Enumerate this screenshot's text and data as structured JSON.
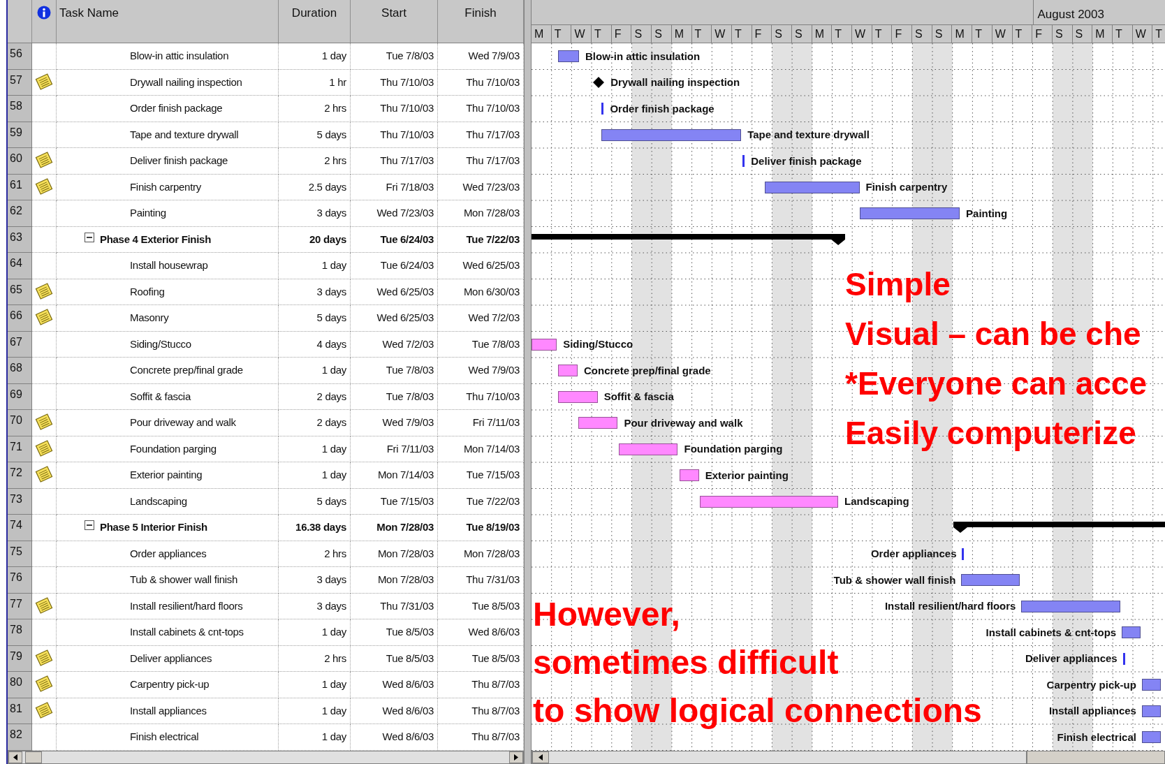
{
  "table": {
    "columns": [
      "Task Name",
      "Duration",
      "Start",
      "Finish"
    ],
    "rows": [
      {
        "kind": "task",
        "id": "56",
        "note": false,
        "name": "Blow-in attic insulation",
        "duration": "1 day",
        "start": "Tue 7/8/03",
        "finish": "Wed 7/9/03",
        "bar_label": "Blow-in attic insulation",
        "color": "#8484f4"
      },
      {
        "kind": "task",
        "id": "57",
        "note": true,
        "name": "Drywall nailing inspection",
        "duration": "1 hr",
        "start": "Thu 7/10/03",
        "finish": "Thu 7/10/03",
        "bar_label": "Drywall nailing inspection"
      },
      {
        "kind": "task",
        "id": "58",
        "note": false,
        "name": "Order finish package",
        "duration": "2 hrs",
        "start": "Thu 7/10/03",
        "finish": "Thu 7/10/03",
        "bar_label": "Order finish package",
        "color": "#3333ee"
      },
      {
        "kind": "task",
        "id": "59",
        "note": false,
        "name": "Tape and texture drywall",
        "duration": "5 days",
        "start": "Thu 7/10/03",
        "finish": "Thu 7/17/03",
        "bar_label": "Tape and texture drywall",
        "color": "#8484f4"
      },
      {
        "kind": "task",
        "id": "60",
        "note": true,
        "name": "Deliver finish package",
        "duration": "2 hrs",
        "start": "Thu 7/17/03",
        "finish": "Thu 7/17/03",
        "bar_label": "Deliver finish package",
        "color": "#3333ee"
      },
      {
        "kind": "task",
        "id": "61",
        "note": true,
        "name": "Finish carpentry",
        "duration": "2.5 days",
        "start": "Fri 7/18/03",
        "finish": "Wed 7/23/03",
        "bar_label": "Finish carpentry",
        "color": "#8484f4"
      },
      {
        "kind": "task",
        "id": "62",
        "note": false,
        "name": "Painting",
        "duration": "3 days",
        "start": "Wed 7/23/03",
        "finish": "Mon 7/28/03",
        "bar_label": "Painting",
        "color": "#8484f4"
      },
      {
        "kind": "summary",
        "id": "63",
        "expanded": true,
        "note": false,
        "name": "Phase 4 Exterior Finish",
        "duration": "20 days",
        "start": "Tue 6/24/03",
        "finish": "Tue 7/22/03",
        "children": [
          {
            "kind": "task",
            "id": "64",
            "note": false,
            "name": "Install housewrap",
            "duration": "1 day",
            "start": "Tue 6/24/03",
            "finish": "Wed 6/25/03"
          },
          {
            "kind": "task",
            "id": "65",
            "note": true,
            "name": "Roofing",
            "duration": "3 days",
            "start": "Wed 6/25/03",
            "finish": "Mon 6/30/03"
          },
          {
            "kind": "task",
            "id": "66",
            "note": true,
            "name": "Masonry",
            "duration": "5 days",
            "start": "Wed 6/25/03",
            "finish": "Wed 7/2/03"
          },
          {
            "kind": "task",
            "id": "67",
            "note": false,
            "name": "Siding/Stucco",
            "duration": "4 days",
            "start": "Wed 7/2/03",
            "finish": "Tue 7/8/03",
            "bar_label": "Siding/Stucco",
            "color": "#ff88ff"
          },
          {
            "kind": "task",
            "id": "68",
            "note": false,
            "name": "Concrete prep/final grade",
            "duration": "1 day",
            "start": "Tue 7/8/03",
            "finish": "Wed 7/9/03",
            "bar_label": "Concrete prep/final grade",
            "color": "#ff88ff"
          },
          {
            "kind": "task",
            "id": "69",
            "note": false,
            "name": "Soffit & fascia",
            "duration": "2 days",
            "start": "Tue 7/8/03",
            "finish": "Thu 7/10/03",
            "bar_label": "Soffit & fascia",
            "color": "#ff88ff"
          },
          {
            "kind": "task",
            "id": "70",
            "note": true,
            "name": "Pour driveway and walk",
            "duration": "2 days",
            "start": "Wed 7/9/03",
            "finish": "Fri 7/11/03",
            "bar_label": "Pour driveway and walk",
            "color": "#ff88ff"
          },
          {
            "kind": "task",
            "id": "71",
            "note": true,
            "name": "Foundation parging",
            "duration": "1 day",
            "start": "Fri 7/11/03",
            "finish": "Mon 7/14/03",
            "bar_label": "Foundation parging",
            "color": "#ff88ff"
          },
          {
            "kind": "task",
            "id": "72",
            "note": true,
            "name": "Exterior painting",
            "duration": "1 day",
            "start": "Mon 7/14/03",
            "finish": "Tue 7/15/03",
            "bar_label": "Exterior painting",
            "color": "#ff88ff"
          },
          {
            "kind": "task",
            "id": "73",
            "note": false,
            "name": "Landscaping",
            "duration": "5 days",
            "start": "Tue 7/15/03",
            "finish": "Tue 7/22/03",
            "bar_label": "Landscaping",
            "color": "#ff88ff"
          }
        ]
      },
      {
        "kind": "summary",
        "id": "74",
        "expanded": true,
        "note": false,
        "name": "Phase 5 Interior Finish",
        "duration": "16.38 days",
        "start": "Mon 7/28/03",
        "finish": "Tue 8/19/03",
        "children": [
          {
            "kind": "task",
            "id": "75",
            "note": false,
            "name": "Order appliances",
            "duration": "2 hrs",
            "start": "Mon 7/28/03",
            "finish": "Mon 7/28/03",
            "bar_label": "Order appliances",
            "color": "#3333ee"
          },
          {
            "kind": "task",
            "id": "76",
            "note": false,
            "name": "Tub & shower wall finish",
            "duration": "3 days",
            "start": "Mon 7/28/03",
            "finish": "Thu 7/31/03",
            "bar_label": "Tub & shower wall finish",
            "color": "#8484f4"
          },
          {
            "kind": "task",
            "id": "77",
            "note": true,
            "name": "Install resilient/hard floors",
            "duration": "3 days",
            "start": "Thu 7/31/03",
            "finish": "Tue 8/5/03",
            "bar_label": "Install resilient/hard floors",
            "color": "#8484f4"
          },
          {
            "kind": "task",
            "id": "78",
            "note": false,
            "name": "Install cabinets & cnt-tops",
            "duration": "1 day",
            "start": "Tue 8/5/03",
            "finish": "Wed 8/6/03",
            "bar_label": "Install cabinets & cnt-tops",
            "color": "#8484f4"
          },
          {
            "kind": "task",
            "id": "79",
            "note": true,
            "name": "Deliver appliances",
            "duration": "2 hrs",
            "start": "Tue 8/5/03",
            "finish": "Tue 8/5/03",
            "bar_label": "Deliver appliances",
            "color": "#3333ee"
          },
          {
            "kind": "task",
            "id": "80",
            "note": true,
            "name": "Carpentry pick-up",
            "duration": "1 day",
            "start": "Wed 8/6/03",
            "finish": "Thu 8/7/03",
            "bar_label": "Carpentry pick-up",
            "color": "#8484f4"
          },
          {
            "kind": "task",
            "id": "81",
            "note": true,
            "name": "Install appliances",
            "duration": "1 day",
            "start": "Wed 8/6/03",
            "finish": "Thu 8/7/03",
            "bar_label": "Install appliances",
            "color": "#8484f4"
          },
          {
            "kind": "task",
            "id": "82",
            "note": false,
            "name": "Finish electrical",
            "duration": "1 day",
            "start": "Wed 8/6/03",
            "finish": "Thu 8/7/03",
            "bar_label": "Finish electrical",
            "color": "#8484f4"
          }
        ]
      }
    ]
  },
  "timescale": {
    "month": "August 2003",
    "days": [
      "M",
      "T",
      "W",
      "T",
      "F",
      "S",
      "S",
      "M",
      "T",
      "W",
      "T",
      "F",
      "S",
      "S",
      "M",
      "T",
      "W",
      "T",
      "F",
      "S",
      "S",
      "M",
      "T",
      "W",
      "T",
      "F",
      "S",
      "S",
      "M",
      "T",
      "W",
      "T"
    ]
  },
  "callouts": [
    {
      "lines": [
        "Simple",
        "Visual – can be che",
        "*Everyone can acce",
        "Easily computerize"
      ]
    },
    {
      "lines": [
        "However,",
        "sometimes difficult",
        "to show logical connections"
      ]
    }
  ]
}
